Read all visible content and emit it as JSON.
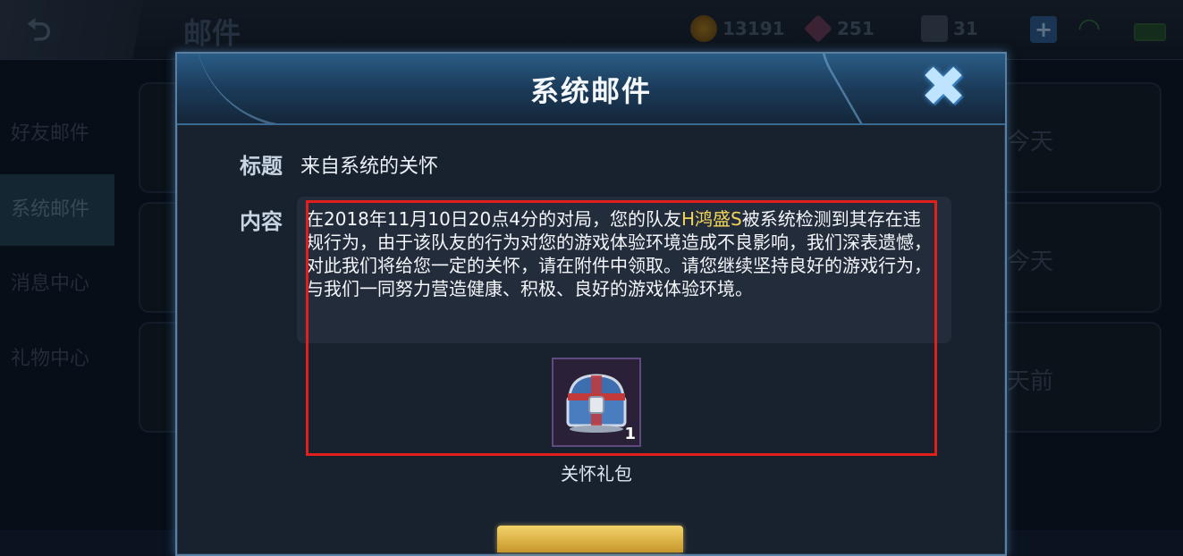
{
  "header": {
    "page_title": "邮件",
    "gold": "13191",
    "gems": "251",
    "coupons": "31"
  },
  "sidebar": {
    "items": [
      {
        "label": "好友邮件"
      },
      {
        "label": "系统邮件",
        "active": true
      },
      {
        "label": "消息中心"
      },
      {
        "label": "礼物中心"
      }
    ]
  },
  "background_list": {
    "times": [
      "今天",
      "今天",
      "天前"
    ]
  },
  "modal": {
    "title": "系统邮件",
    "subject_label": "标题",
    "subject_value": "来自系统的关怀",
    "content_label": "内容",
    "content_before": "在2018年11月10日20点4分的对局，您的队友",
    "content_highlight": "H鸿盛S",
    "content_after": "被系统检测到其存在违规行为，由于该队友的行为对您的游戏体验环境造成不良影响，我们深表遗憾，对此我们将给您一定的关怀，请在附件中领取。请您继续坚持良好的游戏行为，与我们一同努力营造健康、积极、良好的游戏体验环境。",
    "attachment": {
      "name": "关怀礼包",
      "count": "1",
      "icon": "treasure-chest-icon"
    }
  },
  "colors": {
    "highlight_name": "#f2d45a",
    "annotation_frame": "#e0201d",
    "claim_button": "#e8c050"
  }
}
